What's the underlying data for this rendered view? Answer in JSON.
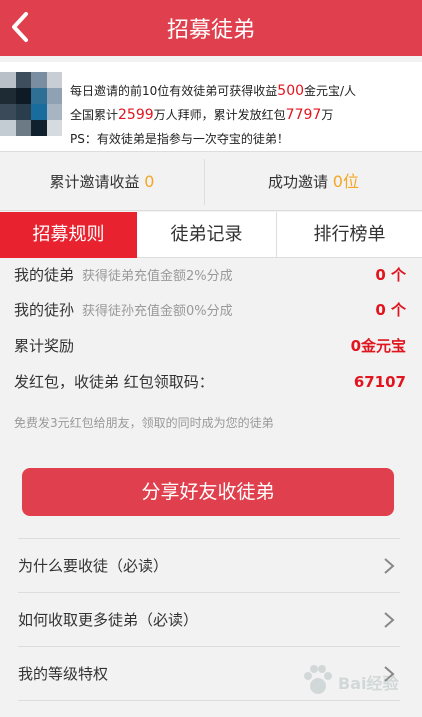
{
  "header": {
    "title": "招募徒弟"
  },
  "info": {
    "line1": {
      "prefix": "每日邀请的前10位有效徒弟可获得收益",
      "amount": "500",
      "suffix": "金元宝/人"
    },
    "line2": {
      "prefix": "全国累计",
      "users": "2599",
      "mid": "万人拜师，累计发放红包",
      "packets": "7797",
      "suffix": "万"
    },
    "line3": "PS：有效徒弟是指参与一次夺宝的徒弟！"
  },
  "stats": {
    "invite_income": {
      "label": "累计邀请收益",
      "value": "0"
    },
    "invite_success": {
      "label": "成功邀请",
      "value": "0位"
    }
  },
  "tabs": [
    {
      "label": "招募规则"
    },
    {
      "label": "徒弟记录"
    },
    {
      "label": "排行榜单"
    }
  ],
  "rules": [
    {
      "label": "我的徒弟",
      "desc": "获得徒弟充值金额2%分成",
      "value": "0 个"
    },
    {
      "label": "我的徒孙",
      "desc": "获得徒孙充值金额0%分成",
      "value": "0 个"
    },
    {
      "label": "累计奖励",
      "desc": "",
      "value": "0金元宝"
    },
    {
      "label": "发红包，收徒弟 红包领取码：",
      "desc": "",
      "value": "67107"
    }
  ],
  "note": "免费发3元红包给朋友，领取的同时成为您的徒弟",
  "share_button": "分享好友收徒弟",
  "menu": [
    {
      "label": "为什么要收徒（必读）"
    },
    {
      "label": "如何收取更多徒弟（必读）"
    },
    {
      "label": "我的等级特权"
    }
  ],
  "watermark": "Bai经验",
  "colors": {
    "brand": "#e0404d",
    "tab_active": "#e8232f",
    "highlight_red": "#e0151f",
    "stat_orange": "#f5a623"
  }
}
